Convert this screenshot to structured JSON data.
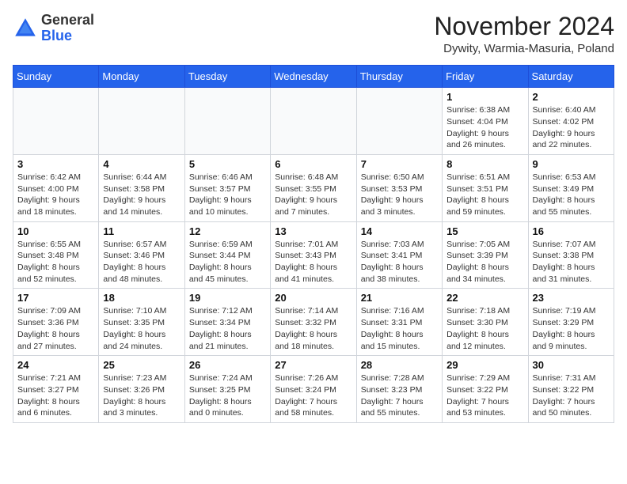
{
  "header": {
    "logo_general": "General",
    "logo_blue": "Blue",
    "month_title": "November 2024",
    "location": "Dywity, Warmia-Masuria, Poland"
  },
  "days_of_week": [
    "Sunday",
    "Monday",
    "Tuesday",
    "Wednesday",
    "Thursday",
    "Friday",
    "Saturday"
  ],
  "weeks": [
    [
      {
        "day": "",
        "info": ""
      },
      {
        "day": "",
        "info": ""
      },
      {
        "day": "",
        "info": ""
      },
      {
        "day": "",
        "info": ""
      },
      {
        "day": "",
        "info": ""
      },
      {
        "day": "1",
        "info": "Sunrise: 6:38 AM\nSunset: 4:04 PM\nDaylight: 9 hours and 26 minutes."
      },
      {
        "day": "2",
        "info": "Sunrise: 6:40 AM\nSunset: 4:02 PM\nDaylight: 9 hours and 22 minutes."
      }
    ],
    [
      {
        "day": "3",
        "info": "Sunrise: 6:42 AM\nSunset: 4:00 PM\nDaylight: 9 hours and 18 minutes."
      },
      {
        "day": "4",
        "info": "Sunrise: 6:44 AM\nSunset: 3:58 PM\nDaylight: 9 hours and 14 minutes."
      },
      {
        "day": "5",
        "info": "Sunrise: 6:46 AM\nSunset: 3:57 PM\nDaylight: 9 hours and 10 minutes."
      },
      {
        "day": "6",
        "info": "Sunrise: 6:48 AM\nSunset: 3:55 PM\nDaylight: 9 hours and 7 minutes."
      },
      {
        "day": "7",
        "info": "Sunrise: 6:50 AM\nSunset: 3:53 PM\nDaylight: 9 hours and 3 minutes."
      },
      {
        "day": "8",
        "info": "Sunrise: 6:51 AM\nSunset: 3:51 PM\nDaylight: 8 hours and 59 minutes."
      },
      {
        "day": "9",
        "info": "Sunrise: 6:53 AM\nSunset: 3:49 PM\nDaylight: 8 hours and 55 minutes."
      }
    ],
    [
      {
        "day": "10",
        "info": "Sunrise: 6:55 AM\nSunset: 3:48 PM\nDaylight: 8 hours and 52 minutes."
      },
      {
        "day": "11",
        "info": "Sunrise: 6:57 AM\nSunset: 3:46 PM\nDaylight: 8 hours and 48 minutes."
      },
      {
        "day": "12",
        "info": "Sunrise: 6:59 AM\nSunset: 3:44 PM\nDaylight: 8 hours and 45 minutes."
      },
      {
        "day": "13",
        "info": "Sunrise: 7:01 AM\nSunset: 3:43 PM\nDaylight: 8 hours and 41 minutes."
      },
      {
        "day": "14",
        "info": "Sunrise: 7:03 AM\nSunset: 3:41 PM\nDaylight: 8 hours and 38 minutes."
      },
      {
        "day": "15",
        "info": "Sunrise: 7:05 AM\nSunset: 3:39 PM\nDaylight: 8 hours and 34 minutes."
      },
      {
        "day": "16",
        "info": "Sunrise: 7:07 AM\nSunset: 3:38 PM\nDaylight: 8 hours and 31 minutes."
      }
    ],
    [
      {
        "day": "17",
        "info": "Sunrise: 7:09 AM\nSunset: 3:36 PM\nDaylight: 8 hours and 27 minutes."
      },
      {
        "day": "18",
        "info": "Sunrise: 7:10 AM\nSunset: 3:35 PM\nDaylight: 8 hours and 24 minutes."
      },
      {
        "day": "19",
        "info": "Sunrise: 7:12 AM\nSunset: 3:34 PM\nDaylight: 8 hours and 21 minutes."
      },
      {
        "day": "20",
        "info": "Sunrise: 7:14 AM\nSunset: 3:32 PM\nDaylight: 8 hours and 18 minutes."
      },
      {
        "day": "21",
        "info": "Sunrise: 7:16 AM\nSunset: 3:31 PM\nDaylight: 8 hours and 15 minutes."
      },
      {
        "day": "22",
        "info": "Sunrise: 7:18 AM\nSunset: 3:30 PM\nDaylight: 8 hours and 12 minutes."
      },
      {
        "day": "23",
        "info": "Sunrise: 7:19 AM\nSunset: 3:29 PM\nDaylight: 8 hours and 9 minutes."
      }
    ],
    [
      {
        "day": "24",
        "info": "Sunrise: 7:21 AM\nSunset: 3:27 PM\nDaylight: 8 hours and 6 minutes."
      },
      {
        "day": "25",
        "info": "Sunrise: 7:23 AM\nSunset: 3:26 PM\nDaylight: 8 hours and 3 minutes."
      },
      {
        "day": "26",
        "info": "Sunrise: 7:24 AM\nSunset: 3:25 PM\nDaylight: 8 hours and 0 minutes."
      },
      {
        "day": "27",
        "info": "Sunrise: 7:26 AM\nSunset: 3:24 PM\nDaylight: 7 hours and 58 minutes."
      },
      {
        "day": "28",
        "info": "Sunrise: 7:28 AM\nSunset: 3:23 PM\nDaylight: 7 hours and 55 minutes."
      },
      {
        "day": "29",
        "info": "Sunrise: 7:29 AM\nSunset: 3:22 PM\nDaylight: 7 hours and 53 minutes."
      },
      {
        "day": "30",
        "info": "Sunrise: 7:31 AM\nSunset: 3:22 PM\nDaylight: 7 hours and 50 minutes."
      }
    ]
  ]
}
